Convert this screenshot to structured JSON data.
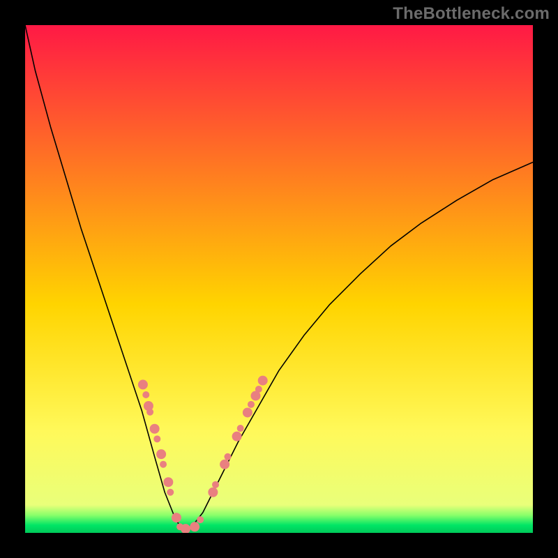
{
  "watermark": "TheBottleneck.com",
  "chart_data": {
    "type": "line",
    "title": "",
    "xlabel": "",
    "ylabel": "",
    "xlim": [
      0,
      100
    ],
    "ylim": [
      0,
      100
    ],
    "grid": false,
    "background_gradient_stops": [
      {
        "offset": 0,
        "color": "#ff1945"
      },
      {
        "offset": 0.55,
        "color": "#ffd400"
      },
      {
        "offset": 0.8,
        "color": "#fff95a"
      },
      {
        "offset": 0.945,
        "color": "#e9ff7a"
      },
      {
        "offset": 0.965,
        "color": "#8aff6a"
      },
      {
        "offset": 0.985,
        "color": "#00e565"
      },
      {
        "offset": 1.0,
        "color": "#00c95a"
      }
    ],
    "series": [
      {
        "name": "curve",
        "x": [
          0,
          2,
          5,
          8,
          11,
          14,
          17,
          20,
          23,
          25.5,
          27.5,
          29.5,
          30.8,
          32.5,
          35,
          39,
          42,
          46,
          50,
          55,
          60,
          66,
          72,
          78,
          85,
          92,
          100
        ],
        "y": [
          100,
          91,
          80,
          70,
          60,
          51,
          42,
          33,
          24,
          15,
          8,
          3,
          0.8,
          0.8,
          4,
          12,
          18,
          25,
          32,
          39,
          45,
          51,
          56.5,
          61,
          65.5,
          69.5,
          73
        ]
      }
    ],
    "markers": {
      "name": "highlight-dots",
      "color": "#e98080",
      "radius_main": 7,
      "radius_small": 5,
      "points": [
        {
          "x": 23.2,
          "y": 29.2,
          "r": 7
        },
        {
          "x": 23.8,
          "y": 27.2,
          "r": 5
        },
        {
          "x": 24.3,
          "y": 25.0,
          "r": 7
        },
        {
          "x": 24.6,
          "y": 23.8,
          "r": 5
        },
        {
          "x": 25.5,
          "y": 20.5,
          "r": 7
        },
        {
          "x": 26.0,
          "y": 18.5,
          "r": 5
        },
        {
          "x": 26.8,
          "y": 15.5,
          "r": 7
        },
        {
          "x": 27.2,
          "y": 13.5,
          "r": 5
        },
        {
          "x": 28.2,
          "y": 10.0,
          "r": 7
        },
        {
          "x": 28.6,
          "y": 8.0,
          "r": 5
        },
        {
          "x": 29.8,
          "y": 3.0,
          "r": 7
        },
        {
          "x": 30.5,
          "y": 1.2,
          "r": 5
        },
        {
          "x": 31.6,
          "y": 0.8,
          "r": 7
        },
        {
          "x": 33.4,
          "y": 1.2,
          "r": 7
        },
        {
          "x": 34.5,
          "y": 2.6,
          "r": 5
        },
        {
          "x": 37.0,
          "y": 8.0,
          "r": 7
        },
        {
          "x": 37.5,
          "y": 9.5,
          "r": 5
        },
        {
          "x": 39.3,
          "y": 13.5,
          "r": 7
        },
        {
          "x": 39.9,
          "y": 15.0,
          "r": 5
        },
        {
          "x": 41.7,
          "y": 19.0,
          "r": 7
        },
        {
          "x": 42.4,
          "y": 20.6,
          "r": 5
        },
        {
          "x": 43.8,
          "y": 23.7,
          "r": 7
        },
        {
          "x": 44.5,
          "y": 25.3,
          "r": 5
        },
        {
          "x": 45.4,
          "y": 27.0,
          "r": 7
        },
        {
          "x": 46.0,
          "y": 28.3,
          "r": 5
        },
        {
          "x": 46.8,
          "y": 30.0,
          "r": 7
        }
      ]
    }
  }
}
